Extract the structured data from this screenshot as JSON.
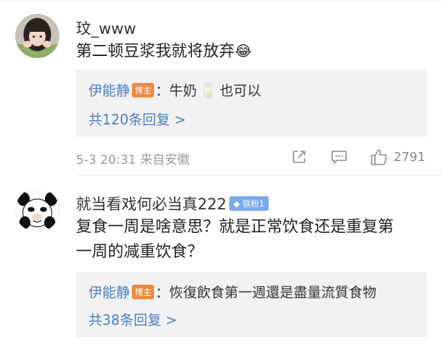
{
  "comments": [
    {
      "username": "玟_www",
      "text": "第二顿豆浆我就将放弃",
      "emoji": "😂",
      "reply": {
        "author": "伊能静",
        "badge": "博主",
        "sep": "：",
        "text_before": "牛奶",
        "emoji": "🥛",
        "text_after": "也可以"
      },
      "more_replies": "共120条回复 >",
      "meta": "5-3 20:31 来自安徽",
      "actions": {
        "likes": "2791"
      }
    },
    {
      "username": "就当看戏何必当真222",
      "fan_badge": "铁粉1",
      "text_line1": "复食一周是啥意思？就是正常饮食还是重复第",
      "text_line2": "一周的减重饮食？",
      "reply": {
        "author": "伊能静",
        "badge": "博主",
        "sep": "：",
        "text": "恢復飲食第一週還是盡量流質食物"
      },
      "more_replies": "共38条回复 >"
    }
  ]
}
